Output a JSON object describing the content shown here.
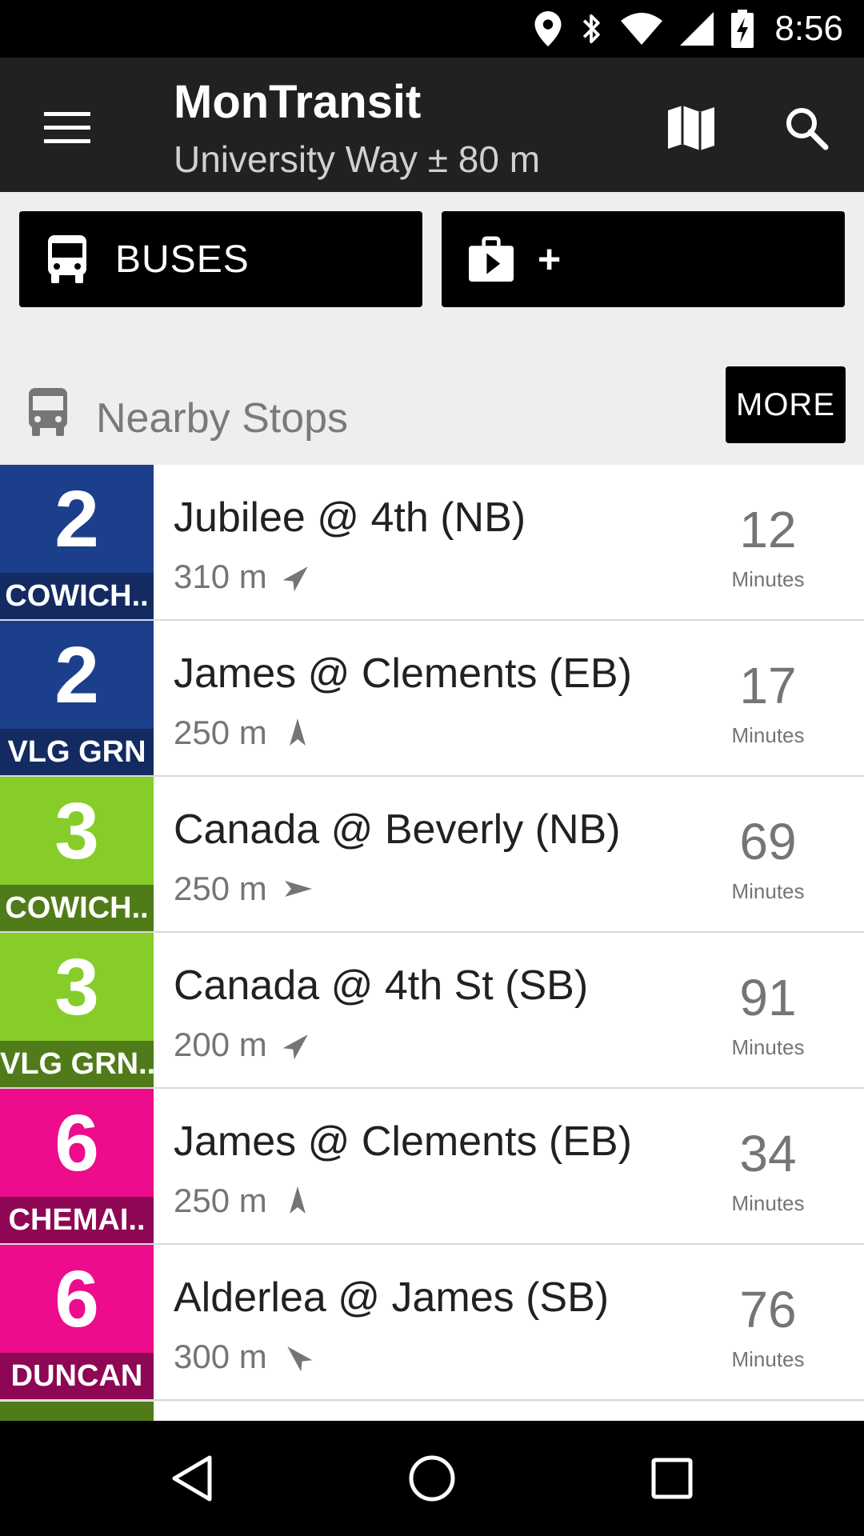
{
  "status_bar": {
    "time": "8:56",
    "icons": [
      "location-icon",
      "bluetooth-icon",
      "wifi-icon",
      "signal-icon",
      "battery-charging-icon"
    ]
  },
  "toolbar": {
    "title": "MonTransit",
    "subtitle": "University Way ± 80 m",
    "menu_icon": "menu-icon",
    "map_icon": "map-icon",
    "search_icon": "search-icon"
  },
  "agency_buttons": {
    "buses_label": "BUSES",
    "add_label": "+"
  },
  "nearby": {
    "title": "Nearby Stops",
    "more_label": "MORE"
  },
  "stops": [
    {
      "route": "2",
      "headsign": "COWICH..",
      "name": "Jubilee @ 4th (NB)",
      "distance": "310 m",
      "eta": "12",
      "eta_unit": "Minutes",
      "tile_color": "#1c3f8c",
      "head_color": "#132b60",
      "arrow_deg": 45
    },
    {
      "route": "2",
      "headsign": "VLG GRN",
      "name": "James @ Clements (EB)",
      "distance": "250 m",
      "eta": "17",
      "eta_unit": "Minutes",
      "tile_color": "#1c3f8c",
      "head_color": "#132b60",
      "arrow_deg": 0
    },
    {
      "route": "3",
      "headsign": "COWICH..",
      "name": "Canada @ Beverly (NB)",
      "distance": "250 m",
      "eta": "69",
      "eta_unit": "Minutes",
      "tile_color": "#86cd2a",
      "head_color": "#507b19",
      "arrow_deg": 90
    },
    {
      "route": "3",
      "headsign": "VLG GRN..",
      "name": "Canada @ 4th St (SB)",
      "distance": "200 m",
      "eta": "91",
      "eta_unit": "Minutes",
      "tile_color": "#86cd2a",
      "head_color": "#507b19",
      "arrow_deg": 45
    },
    {
      "route": "6",
      "headsign": "CHEMAI..",
      "name": "James @ Clements (EB)",
      "distance": "250 m",
      "eta": "34",
      "eta_unit": "Minutes",
      "tile_color": "#ec0c8c",
      "head_color": "#8e0754",
      "arrow_deg": 0
    },
    {
      "route": "6",
      "headsign": "DUNCAN",
      "name": "Alderlea @ James (SB)",
      "distance": "300 m",
      "eta": "76",
      "eta_unit": "Minutes",
      "tile_color": "#ec0c8c",
      "head_color": "#8e0754",
      "arrow_deg": -45
    }
  ],
  "partial_tile_color": "#507b19",
  "nav_bar": {
    "back_icon": "back-icon",
    "home_icon": "home-icon",
    "recents_icon": "recents-icon"
  }
}
